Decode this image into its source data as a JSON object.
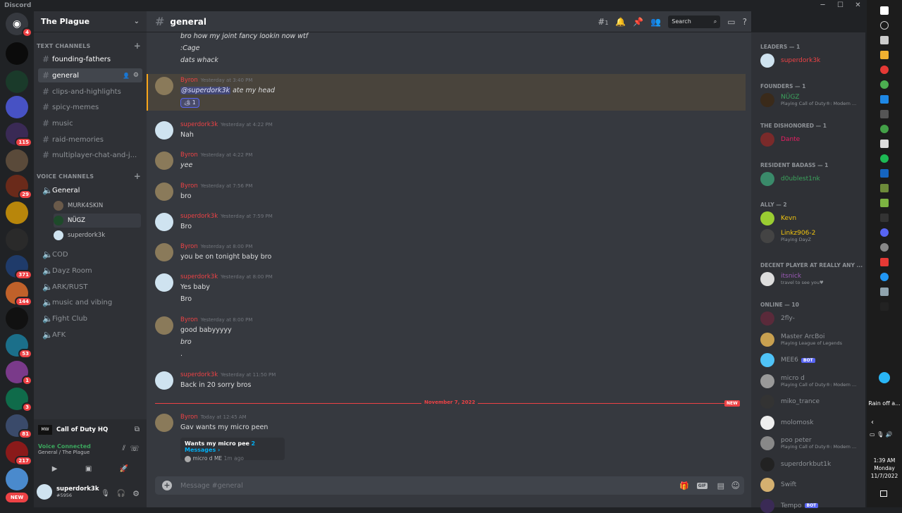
{
  "app": {
    "title": "Discord"
  },
  "servers": [
    {
      "badge": "4"
    },
    {
      "badge": ""
    },
    {
      "badge": ""
    },
    {
      "badge": ""
    },
    {
      "badge": "115"
    },
    {
      "badge": ""
    },
    {
      "badge": "29"
    },
    {
      "badge": ""
    },
    {
      "badge": ""
    },
    {
      "badge": "371"
    },
    {
      "badge": "144"
    },
    {
      "badge": ""
    },
    {
      "badge": "53"
    },
    {
      "badge": "1"
    },
    {
      "badge": "3"
    },
    {
      "badge": "81"
    },
    {
      "badge": "217"
    },
    {
      "badge": "NEW"
    }
  ],
  "guild": {
    "name": "The Plague"
  },
  "text_category": "TEXT CHANNELS",
  "voice_category": "VOICE CHANNELS",
  "text_channels": [
    "founding-fathers",
    "general",
    "clips-and-highlights",
    "spicy-memes",
    "music",
    "raid-memories",
    "multiplayer-chat-and-j..."
  ],
  "voice_channels": [
    "General",
    "COD",
    "Dayz Room",
    "ARK/RUST",
    "music and vibing",
    "Fight Club",
    "AFK"
  ],
  "voice_users": [
    "MURK4SKIN",
    "NÜGZ",
    "superdork3k"
  ],
  "activity": {
    "name": "Call of Duty HQ"
  },
  "voice_status": {
    "label": "Voice Connected",
    "sub": "General / The Plague"
  },
  "user": {
    "name": "superdork3k",
    "tag": "#5956"
  },
  "channel": {
    "name": "general",
    "threads_count": "1",
    "search_placeholder": "Search"
  },
  "messages": {
    "top_lines": [
      "bro how my joint fancy lookin now wtf",
      ":Cage",
      "dats whack"
    ],
    "m1": {
      "author": "Byron",
      "time": "Yesterday at 3:40 PM",
      "mention": "@superdork3k",
      "text": " ate my head",
      "reaction": "1"
    },
    "m2": {
      "author": "superdork3k",
      "time": "Yesterday at 4:22 PM",
      "text": "Nah"
    },
    "m3": {
      "author": "Byron",
      "time": "Yesterday at 4:22 PM",
      "text": "yee"
    },
    "m4": {
      "author": "Byron",
      "time": "Yesterday at 7:56 PM",
      "text": "bro"
    },
    "m5": {
      "author": "superdork3k",
      "time": "Yesterday at 7:59 PM",
      "text": "Bro"
    },
    "m6": {
      "author": "Byron",
      "time": "Yesterday at 8:00 PM",
      "text": "you be on tonight baby bro"
    },
    "m7": {
      "author": "superdork3k",
      "time": "Yesterday at 8:00 PM",
      "text": "Yes baby",
      "text2": "Bro"
    },
    "m8": {
      "author": "Byron",
      "time": "Yesterday at 8:00 PM",
      "text": "good babyyyyy",
      "text2": "bro",
      "text3": "."
    },
    "m9": {
      "author": "superdork3k",
      "time": "Yesterday at 11:50 PM",
      "text": "Back in 20 sorry bros"
    },
    "divider": "November 7, 2022",
    "new_badge": "NEW",
    "m10": {
      "author": "Byron",
      "time": "Today at 12:45 AM",
      "text": "Gav wants my micro peen",
      "thread_name": "Wants my micro pee",
      "thread_count": "2 Messages ›",
      "thread_author": "micro d",
      "thread_text": "ME",
      "thread_time": "1m ago"
    }
  },
  "input": {
    "placeholder": "Message #general"
  },
  "members": {
    "groups": [
      "LEADERS — 1",
      "FOUNDERS — 1",
      "THE DISHONORED — 1",
      "RESIDENT BADASS — 1",
      "ALLY — 2",
      "DECENT PLAYER AT REALLY ANY ...",
      "ONLINE — 10"
    ],
    "list": [
      {
        "name": "superdork3k",
        "status": "",
        "color": "#ed4245"
      },
      {
        "name": "NÜGZ",
        "status": "Playing Call of Duty®: Modern ...",
        "color": "#3ba55d"
      },
      {
        "name": "Dante",
        "status": "",
        "color": "#e91e63"
      },
      {
        "name": "d0ublest1nk",
        "status": "",
        "color": "#3ba55d"
      },
      {
        "name": "Kevn",
        "status": "",
        "color": "#f1c40f"
      },
      {
        "name": "Linkz906-2",
        "status": "Playing DayZ",
        "color": "#f1c40f"
      },
      {
        "name": "itsnick",
        "status": "travel to see you♥",
        "color": "#9b59b6"
      },
      {
        "name": "2fly-",
        "status": "",
        "color": "#8e9297"
      },
      {
        "name": "Master ArcBoi",
        "status": "Playing League of Legends",
        "color": "#8e9297"
      },
      {
        "name": "MEE6",
        "status": "",
        "color": "#8e9297",
        "bot": "BOT"
      },
      {
        "name": "micro d",
        "status": "Playing Call of Duty®: Modern ...",
        "color": "#8e9297"
      },
      {
        "name": "miko_trance",
        "status": "",
        "color": "#8e9297"
      },
      {
        "name": "molomosk",
        "status": "",
        "color": "#8e9297"
      },
      {
        "name": "poo peter",
        "status": "Playing Call of Duty®: Modern ...",
        "color": "#8e9297"
      },
      {
        "name": "superdorkbut1k",
        "status": "",
        "color": "#8e9297"
      },
      {
        "name": "Swift",
        "status": "",
        "color": "#8e9297"
      },
      {
        "name": "Tempo",
        "status": "",
        "color": "#8e9297",
        "bot": "BOT"
      }
    ]
  },
  "taskbar": {
    "weather": "Rain off a...",
    "time": "1:39 AM",
    "day": "Monday",
    "date": "11/7/2022"
  }
}
